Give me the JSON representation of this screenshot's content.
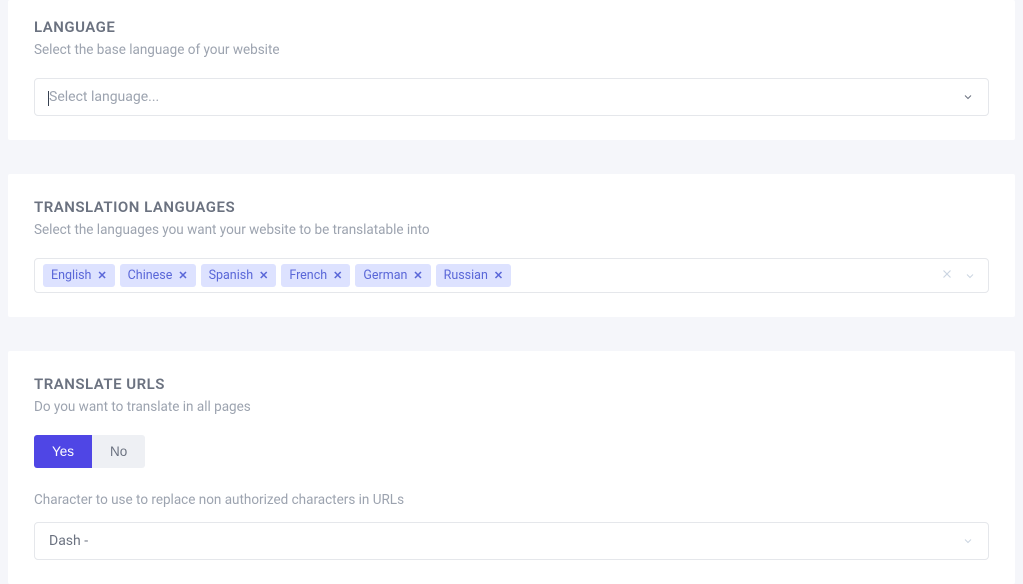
{
  "language": {
    "title": "LANGUAGE",
    "desc": "Select the base language of your website",
    "placeholder": "Select language..."
  },
  "translation": {
    "title": "TRANSLATION LANGUAGES",
    "desc": "Select the languages you want your website to be translatable into",
    "tags": [
      "English",
      "Chinese",
      "Spanish",
      "French",
      "German",
      "Russian"
    ]
  },
  "urls": {
    "title": "TRANSLATE URLS",
    "desc": "Do you want to translate in all pages",
    "yes": "Yes",
    "no": "No",
    "char_label": "Character to use to replace non authorized characters in URLs",
    "char_value": "Dash -"
  }
}
